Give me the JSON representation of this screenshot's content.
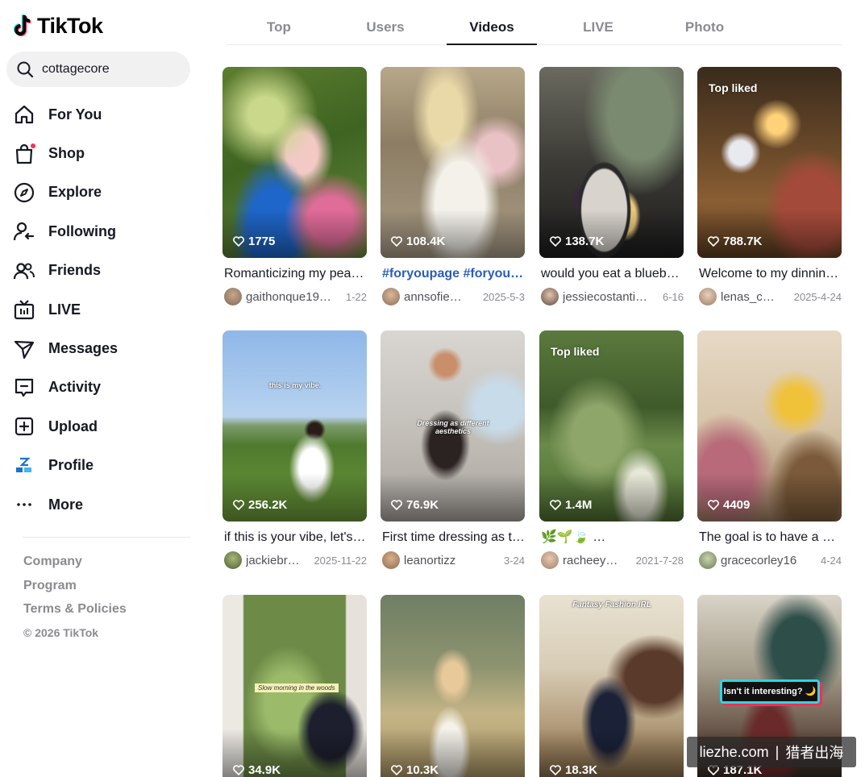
{
  "app": {
    "name": "TikTok"
  },
  "search": {
    "value": "cottagecore"
  },
  "nav": [
    {
      "label": "For You",
      "icon": "home-icon"
    },
    {
      "label": "Shop",
      "icon": "shopping-bag-icon"
    },
    {
      "label": "Explore",
      "icon": "compass-icon"
    },
    {
      "label": "Following",
      "icon": "following-icon"
    },
    {
      "label": "Friends",
      "icon": "friends-icon"
    },
    {
      "label": "LIVE",
      "icon": "tv-icon"
    },
    {
      "label": "Messages",
      "icon": "send-icon"
    },
    {
      "label": "Activity",
      "icon": "activity-icon"
    },
    {
      "label": "Upload",
      "icon": "plus-square-icon"
    },
    {
      "label": "Profile",
      "icon": "profile-avatar"
    },
    {
      "label": "More",
      "icon": "more-icon"
    }
  ],
  "footer": {
    "links": [
      "Company",
      "Program",
      "Terms & Policies"
    ],
    "copyright": "© 2026 TikTok"
  },
  "tabs": [
    {
      "label": "Top",
      "active": false
    },
    {
      "label": "Users",
      "active": false
    },
    {
      "label": "Videos",
      "active": true
    },
    {
      "label": "LIVE",
      "active": false
    },
    {
      "label": "Photo",
      "active": false
    }
  ],
  "videos": [
    {
      "likes": "1775",
      "caption": "Romanticizing my pea…",
      "user": "gaithonque19…",
      "date": "1-22",
      "top_liked": ""
    },
    {
      "likes": "108.4K",
      "caption": "#foryoupage #foryou …",
      "user": "annsofie…",
      "date": "2025-5-3",
      "top_liked": ""
    },
    {
      "likes": "138.7K",
      "caption": "would you eat a blueb…",
      "user": "jessiecostanti…",
      "date": "6-16",
      "top_liked": ""
    },
    {
      "likes": "788.7K",
      "caption": "Welcome to my dinnin…",
      "user": "lenas_c…",
      "date": "2025-4-24",
      "top_liked": "Top liked"
    },
    {
      "likes": "256.2K",
      "caption": "if this is your vibe, let's…",
      "user": "jackiebr…",
      "date": "2025-11-22",
      "top_liked": ""
    },
    {
      "likes": "76.9K",
      "caption": "First time dressing as t…",
      "user": "leanortizz",
      "date": "3-24",
      "top_liked": ""
    },
    {
      "likes": "1.4M",
      "caption": "🌿🌱🍃 …",
      "user": "racheey…",
      "date": "2021-7-28",
      "top_liked": "Top liked"
    },
    {
      "likes": "4409",
      "caption": "The goal is to have a h…",
      "user": "gracecorley16",
      "date": "4-24",
      "top_liked": ""
    },
    {
      "likes": "34.9K",
      "caption": "",
      "user": "",
      "date": "",
      "top_liked": ""
    },
    {
      "likes": "10.3K",
      "caption": "",
      "user": "",
      "date": "",
      "top_liked": ""
    },
    {
      "likes": "18.3K",
      "caption": "",
      "user": "",
      "date": "",
      "top_liked": ""
    },
    {
      "likes": "187.1K",
      "caption": "",
      "user": "",
      "date": "",
      "top_liked": ""
    }
  ],
  "overlay_text": {
    "vibe": "this is my vibe.",
    "dressing": "Dressing as different aesthetics",
    "slow_morning": "Slow morning in the woods",
    "fantasy": "Fantasy Fashion IRL",
    "interesting": "Isn't it interesting? 🌙"
  },
  "watermark": {
    "site": "liezhe.com",
    "sep": "|",
    "name": "猎者出海"
  },
  "colors": {
    "accent": "#fe2c55",
    "tag_blue": "#2b5db9",
    "muted": "#8a8b91"
  }
}
